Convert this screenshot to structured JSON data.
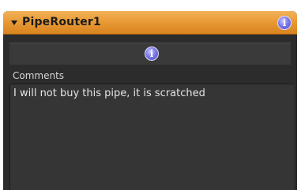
{
  "panel": {
    "title": "PipeRouter1",
    "title_info_icon": "info-icon",
    "collapse_icon": "collapse-triangle-icon"
  },
  "info_row": {
    "icon": "info-icon"
  },
  "comments": {
    "label": "Comments",
    "value": "I will not buy this pipe, it is scratched"
  },
  "colors": {
    "titlebar": "#e99b36",
    "panel_background": "#2c2c2c",
    "text_field": "#353535",
    "info_icon": "#7d7ae8"
  }
}
